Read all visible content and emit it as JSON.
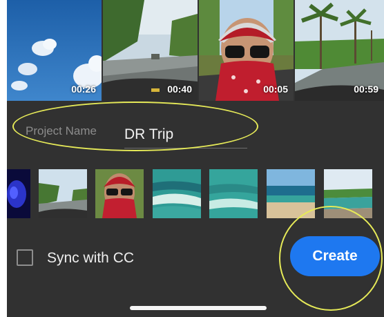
{
  "clips": [
    {
      "name": "sky",
      "duration": "00:26"
    },
    {
      "name": "road-trees",
      "duration": "00:40"
    },
    {
      "name": "selfie",
      "duration": "00:05"
    },
    {
      "name": "palm-road",
      "duration": "00:59"
    }
  ],
  "project": {
    "label": "Project Name",
    "value": "DR Trip"
  },
  "sync": {
    "label": "Sync with CC",
    "checked": false
  },
  "create_label": "Create",
  "colors": {
    "background": "#313131",
    "accent": "#1e78f0",
    "annotation": "#e6ea58"
  }
}
